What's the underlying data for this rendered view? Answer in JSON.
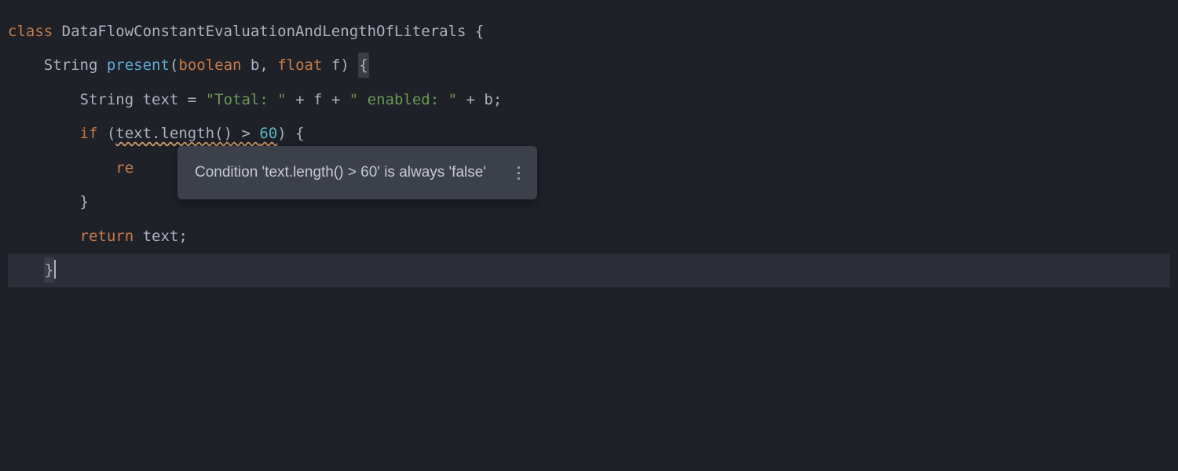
{
  "code": {
    "line1": {
      "kw_class": "class",
      "class_name": " DataFlowConstantEvaluationAndLengthOfLiterals ",
      "brace": "{"
    },
    "line2": {
      "indent": "    ",
      "ret_type": "String ",
      "method_name": "present",
      "paren_open": "(",
      "p1_type": "boolean",
      "p1_name": " b",
      "comma": ", ",
      "p2_type": "float",
      "p2_name": " f",
      "paren_close": ") ",
      "brace": "{"
    },
    "line3": {
      "indent": "        ",
      "type": "String ",
      "var": "text ",
      "eq": "= ",
      "str1": "\"Total: \"",
      "plus1": " + ",
      "f": "f",
      "plus2": " + ",
      "str2": "\" enabled: \"",
      "plus3": " + ",
      "b": "b",
      "semi": ";"
    },
    "line4": {
      "indent": "        ",
      "kw_if": "if",
      "open": " (",
      "cond_left": "text.length() > ",
      "cond_num": "60",
      "close": ") {"
    },
    "line5": {
      "indent": "            ",
      "partial_kw": "re"
    },
    "line6": {
      "indent": "        ",
      "brace": "}"
    },
    "line7": {
      "indent": "        ",
      "kw_return": "return",
      "expr": " text;"
    },
    "line8": {
      "indent": "    ",
      "brace": "}"
    }
  },
  "tooltip": {
    "message": "Condition 'text.length() > 60' is always 'false'"
  }
}
